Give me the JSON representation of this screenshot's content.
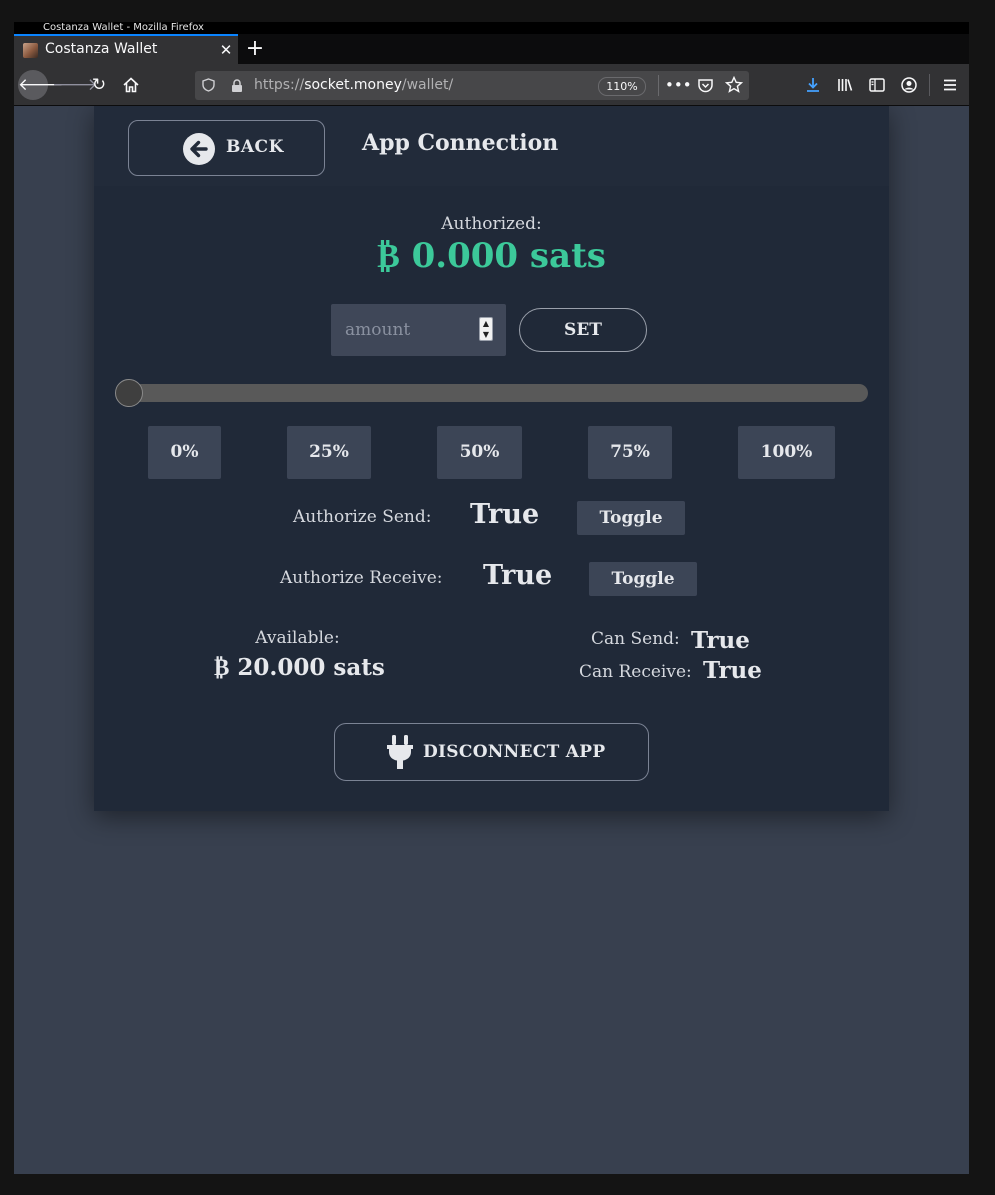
{
  "window": {
    "title": "Costanza Wallet - Mozilla Firefox"
  },
  "browser": {
    "tab_title": "Costanza Wallet",
    "url_scheme": "https://",
    "url_host": "socket.money",
    "url_path": "/wallet/",
    "zoom": "110%",
    "accent_color": "#0a84ff"
  },
  "page": {
    "back_label": "BACK",
    "title": "App Connection",
    "authorized_label": "Authorized:",
    "authorized_value": "₿ 0.000 sats",
    "authorized_color": "#3cc99a",
    "amount_placeholder": "amount",
    "set_label": "SET",
    "slider_fraction": 0,
    "percent_buttons": [
      "0%",
      "25%",
      "50%",
      "75%",
      "100%"
    ],
    "authorize_send_label": "Authorize Send:",
    "authorize_send_value": "True",
    "authorize_receive_label": "Authorize Receive:",
    "authorize_receive_value": "True",
    "toggle_label": "Toggle",
    "available_label": "Available:",
    "available_value": "₿ 20.000 sats",
    "can_send_label": "Can Send:",
    "can_send_value": "True",
    "can_receive_label": "Can Receive:",
    "can_receive_value": "True",
    "disconnect_label": "DISCONNECT APP"
  }
}
